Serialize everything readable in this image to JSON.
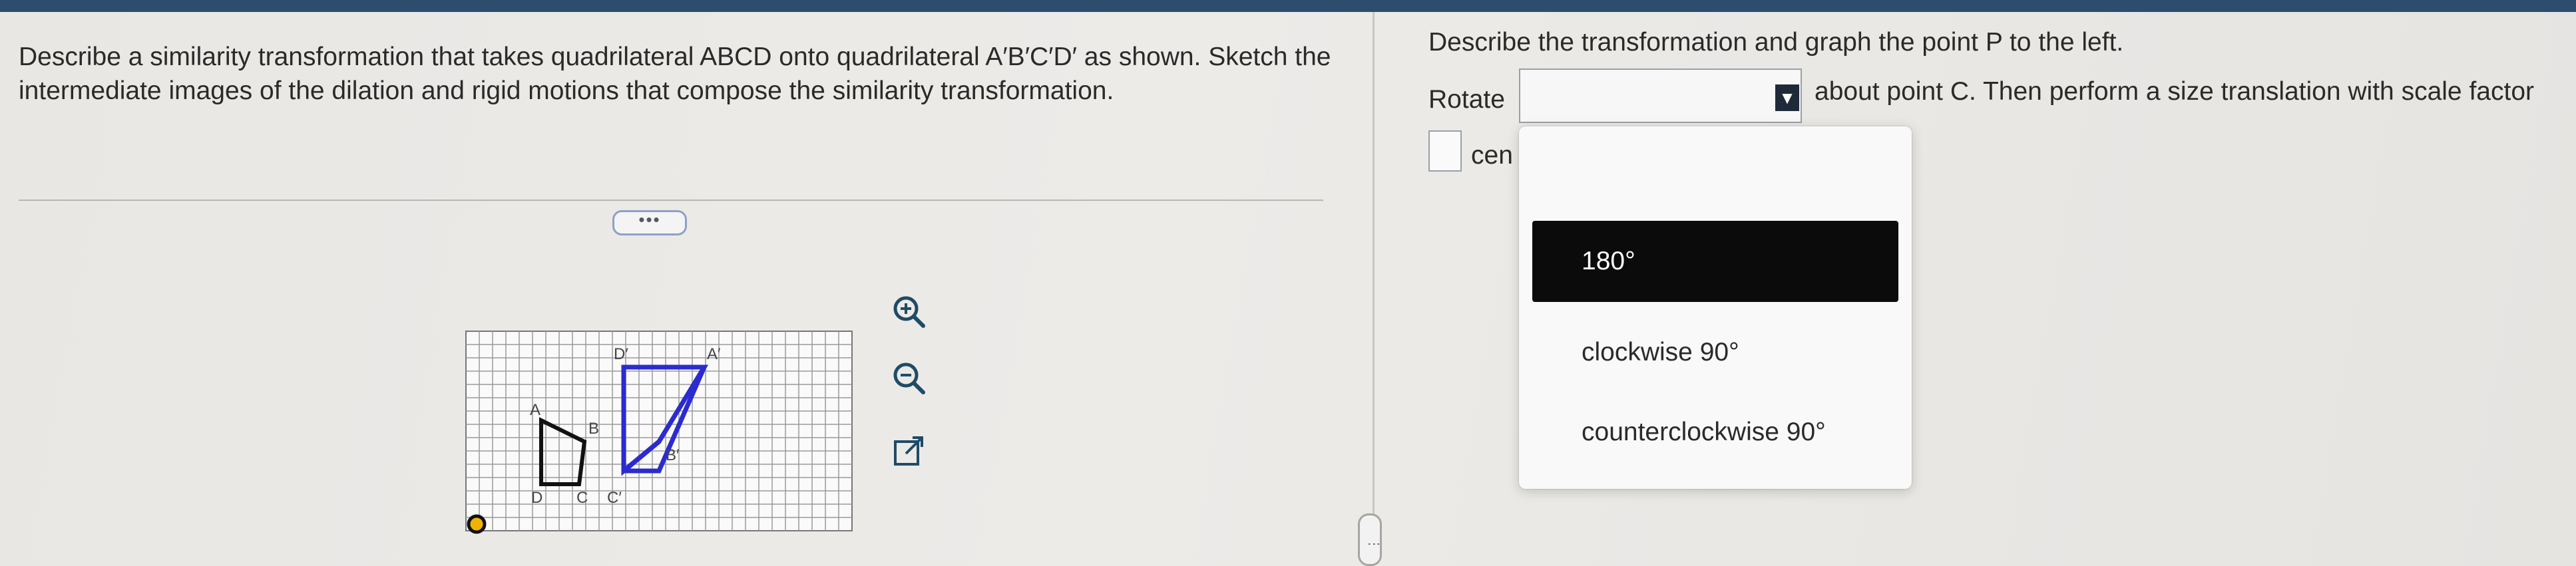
{
  "problem": {
    "prompt": "Describe a similarity transformation that takes quadrilateral ABCD onto quadrilateral A′B′C′D′ as shown. Sketch the intermediate images of the dilation and rigid motions that compose the similarity transformation.",
    "more_button": "•••"
  },
  "graph": {
    "original_labels": {
      "A": "A",
      "B": "B",
      "C": "C",
      "D": "D"
    },
    "image_labels": {
      "A": "A′",
      "B": "B′",
      "C": "C′",
      "D": "D′"
    },
    "original_color": "#111111",
    "image_color": "#2b2bd0",
    "point_color": "#f0b400",
    "tools": [
      "zoom-in-icon",
      "zoom-out-icon",
      "popout-icon"
    ]
  },
  "answer": {
    "instruction": "Describe the transformation and graph the point P to the left.",
    "rotate_label": "Rotate",
    "after_select": "about point C. Then perform a size translation with scale factor",
    "cen_text": "cen",
    "dropdown_options": [
      "180°",
      "clockwise 90°",
      "counterclockwise 90°"
    ],
    "selected_index": 0
  },
  "colors": {
    "top_bar": "#2d4d6e",
    "selected_option_bg": "#0b0b0b"
  }
}
